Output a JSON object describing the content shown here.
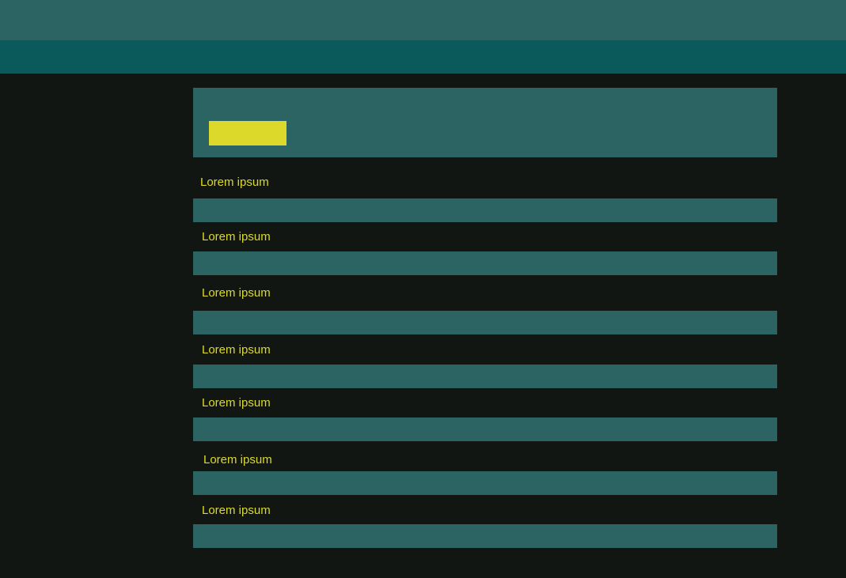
{
  "colors": {
    "background": "#111612",
    "top_bar": "#2b6462",
    "nav_bar": "#0b5a5b",
    "panel": "#2b6462",
    "accent": "#ddd92a",
    "text": "#ddd92a"
  },
  "hero": {
    "button_label": ""
  },
  "sections": [
    {
      "label": "Lorem ipsum"
    },
    {
      "label": "Lorem ipsum"
    },
    {
      "label": "Lorem ipsum"
    },
    {
      "label": "Lorem ipsum"
    },
    {
      "label": "Lorem ipsum"
    },
    {
      "label": "Lorem ipsum"
    },
    {
      "label": "Lorem ipsum"
    }
  ]
}
